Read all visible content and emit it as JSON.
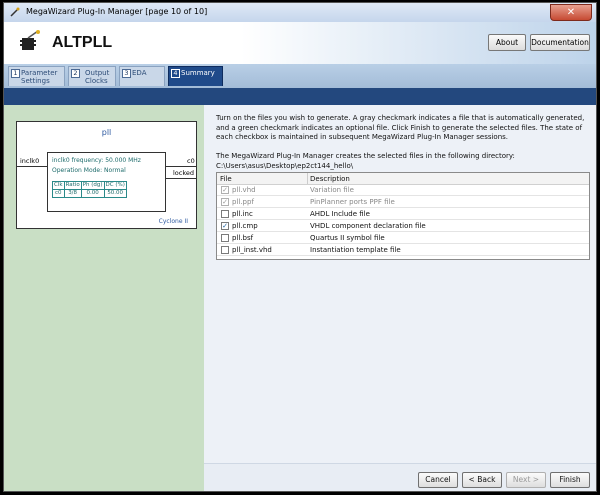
{
  "window": {
    "title": "MegaWizard Plug-In Manager [page 10 of 10]",
    "close_label": "✕"
  },
  "header": {
    "product": "ALTPLL",
    "about_label": "About",
    "documentation_label": "Documentation"
  },
  "tabs": [
    {
      "num": "1",
      "label_line1": "Parameter",
      "label_line2": "Settings",
      "active": false
    },
    {
      "num": "2",
      "label_line1": "Output",
      "label_line2": "Clocks",
      "active": false
    },
    {
      "num": "3",
      "label_line1": "EDA",
      "label_line2": "",
      "active": false
    },
    {
      "num": "4",
      "label_line1": "Summary",
      "label_line2": "",
      "active": true
    }
  ],
  "pll": {
    "name": "pll",
    "input_port": "inclk0",
    "output_c0": "c0",
    "output_locked": "locked",
    "freq_text": "inclk0 frequency: 50.000 MHz",
    "mode_text": "Operation Mode: Normal",
    "table_header": [
      "Clk",
      "Ratio",
      "Ph (dg)",
      "DC (%)"
    ],
    "table_row": [
      "c0",
      "3/8",
      "0.00",
      "50.00"
    ],
    "device": "Cyclone II"
  },
  "summary": {
    "description": "Turn on the files you wish to generate. A gray checkmark indicates a file that is automatically generated, and a green checkmark indicates an optional file. Click Finish to generate the selected files. The state of each checkbox is maintained in subsequent MegaWizard Plug-In Manager sessions.",
    "dir_text": "The MegaWizard Plug-In Manager creates the selected files in the following directory:",
    "dir_path": "C:\\Users\\asus\\Desktop\\ep2ct144_hello\\"
  },
  "files": {
    "col_file": "File",
    "col_desc": "Description",
    "rows": [
      {
        "name": "pll.vhd",
        "desc": "Variation file",
        "state": "gray"
      },
      {
        "name": "pll.ppf",
        "desc": "PinPlanner ports PPF file",
        "state": "gray"
      },
      {
        "name": "pll.inc",
        "desc": "AHDL Include file",
        "state": "off"
      },
      {
        "name": "pll.cmp",
        "desc": "VHDL component declaration file",
        "state": "on"
      },
      {
        "name": "pll.bsf",
        "desc": "Quartus II symbol file",
        "state": "off"
      },
      {
        "name": "pll_inst.vhd",
        "desc": "Instantiation template file",
        "state": "off"
      }
    ]
  },
  "footer": {
    "cancel": "Cancel",
    "back": "< Back",
    "next": "Next >",
    "finish": "Finish"
  }
}
